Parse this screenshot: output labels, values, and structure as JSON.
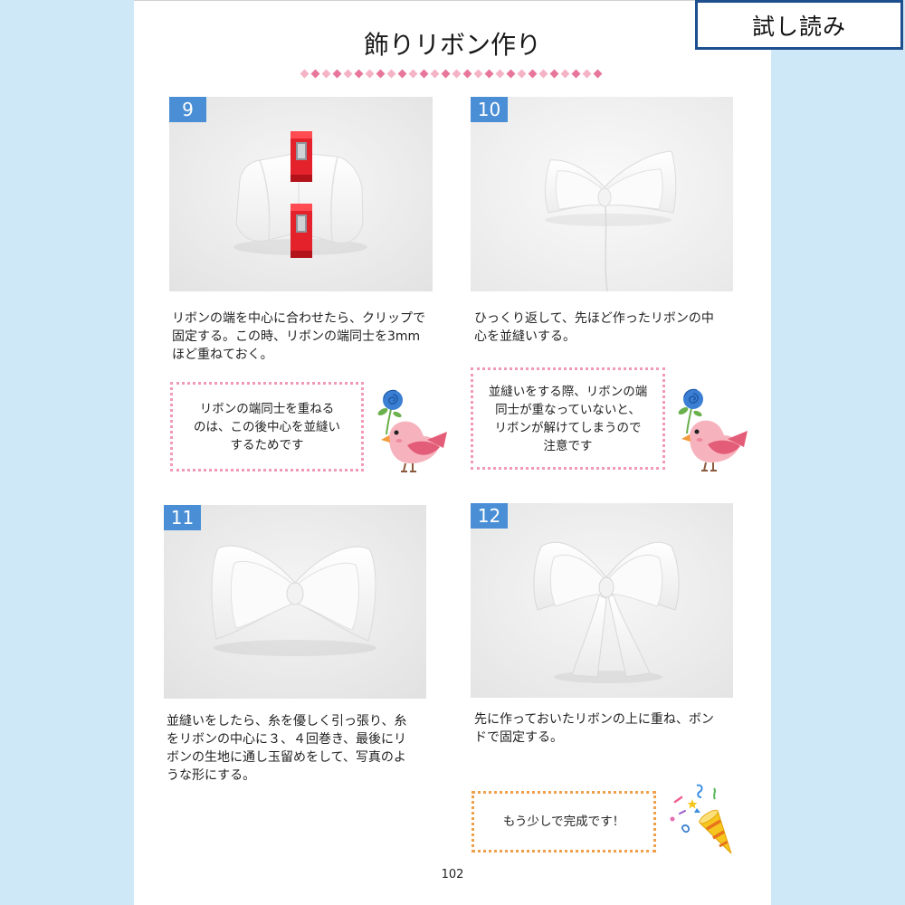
{
  "header": {
    "title": "飾りリボン作り",
    "preview_label": "試し読み"
  },
  "steps": [
    {
      "number": "9",
      "text_lines": [
        "リボンの端を中心に合わせたら、クリップで",
        "固定する。この時、リボンの端同士を3mm",
        "ほど重ねておく。"
      ],
      "note_lines": [
        "リボンの端同士を重ねる",
        "のは、この後中心を並縫い",
        "するためです"
      ],
      "note_icon": "bird-icon"
    },
    {
      "number": "10",
      "text_lines": [
        "ひっくり返して、先ほど作ったリボンの中",
        "心を並縫いする。"
      ],
      "note_lines": [
        "並縫いをする際、リボンの端",
        "同士が重なっていないと、",
        "リボンが解けてしまうので",
        "注意です"
      ],
      "note_icon": "bird-icon"
    },
    {
      "number": "11",
      "text_lines": [
        "並縫いをしたら、糸を優しく引っ張り、糸",
        "をリボンの中心に３、４回巻き、最後にリ",
        "ボンの生地に通し玉留めをして、写真のよ",
        "うな形にする。"
      ]
    },
    {
      "number": "12",
      "text_lines": [
        "先に作っておいたリボンの上に重ね、ボン",
        "ドで固定する。"
      ],
      "note_lines": [
        "もう少しで完成です！"
      ],
      "note_icon": "party-popper-icon"
    }
  ],
  "page_number": "102",
  "colors": {
    "page_background": "#cfe8f7",
    "preview_border": "#1d4f8f",
    "step_badge": "#4a8fd6",
    "note_border": "#f29ab5",
    "final_note_border": "#f0a04b",
    "divider_light": "#f5b3c6",
    "divider_dark": "#e8769a"
  }
}
